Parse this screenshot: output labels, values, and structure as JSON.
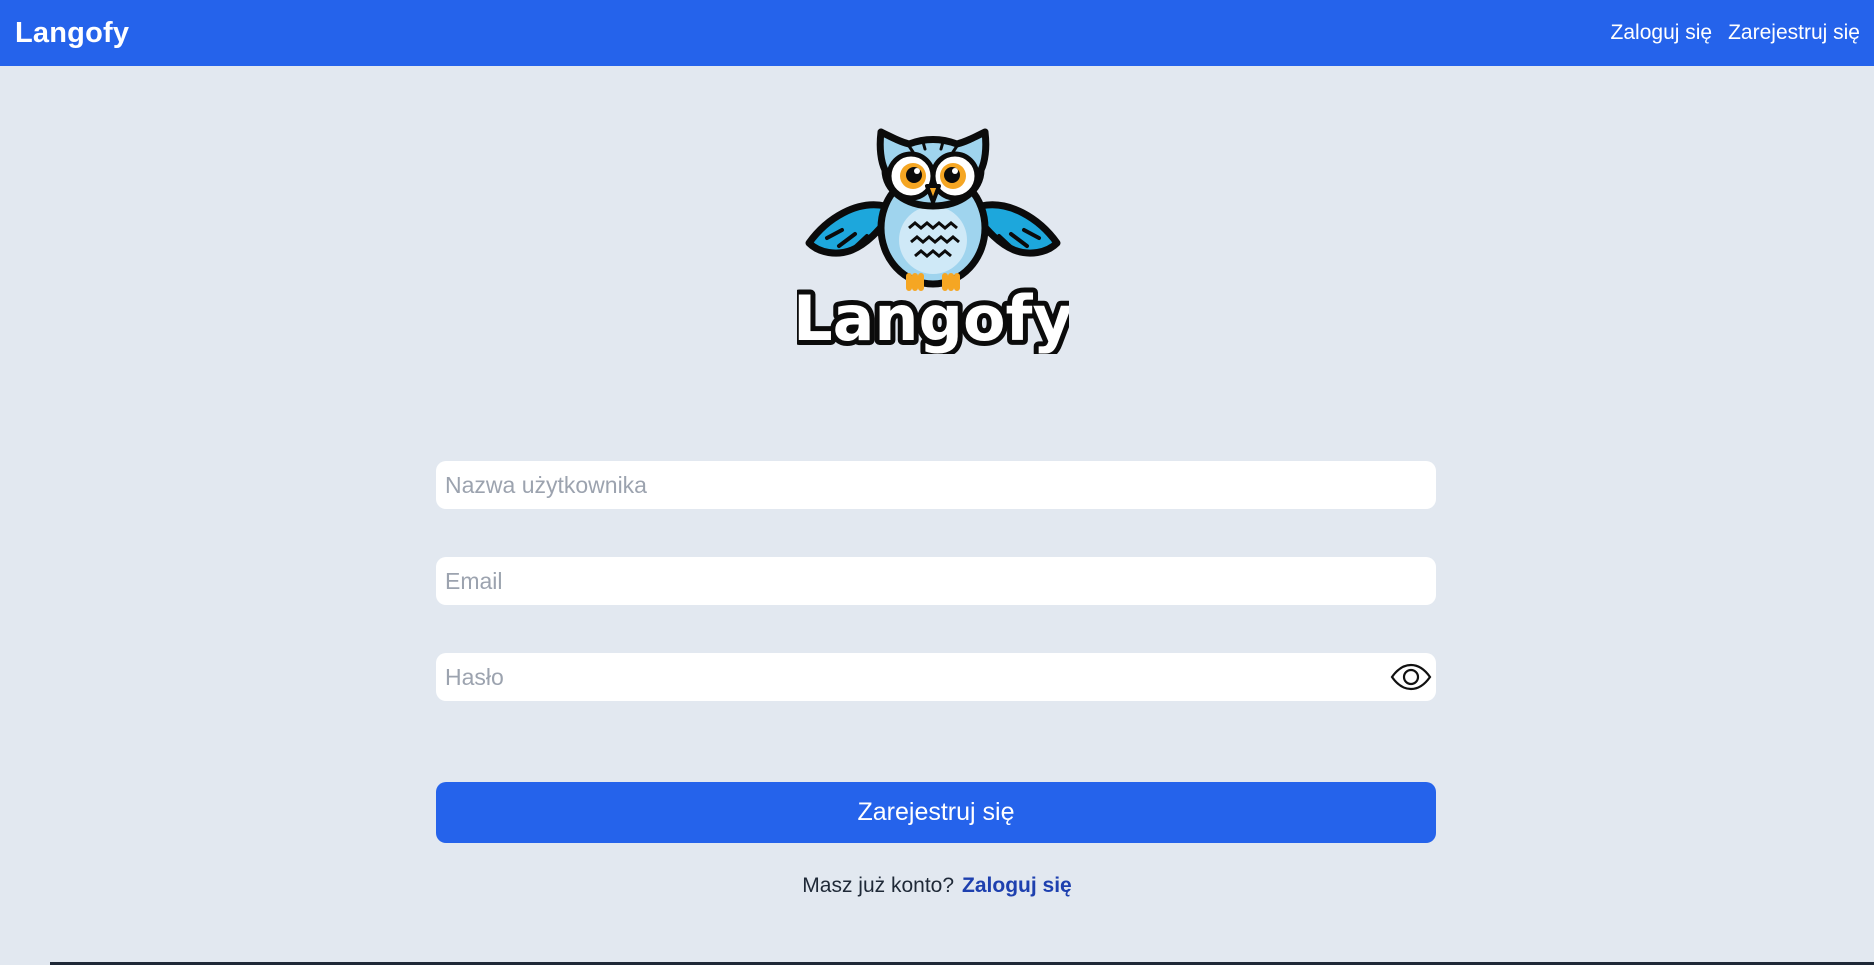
{
  "header": {
    "brand": "Langofy",
    "nav": {
      "login": "Zaloguj się",
      "register": "Zarejestruj się"
    }
  },
  "logo": {
    "wordmark": "Langofy",
    "icon": "owl-mascot"
  },
  "form": {
    "username": {
      "placeholder": "Nazwa użytkownika",
      "value": ""
    },
    "email": {
      "placeholder": "Email",
      "value": ""
    },
    "password": {
      "placeholder": "Hasło",
      "value": "",
      "toggle_icon": "eye-icon"
    },
    "submit_label": "Zarejestruj się"
  },
  "footer": {
    "question": "Masz już konto?",
    "login_link": "Zaloguj się"
  },
  "colors": {
    "primary": "#2563eb",
    "background": "#e2e8f0",
    "link": "#1e40af"
  }
}
